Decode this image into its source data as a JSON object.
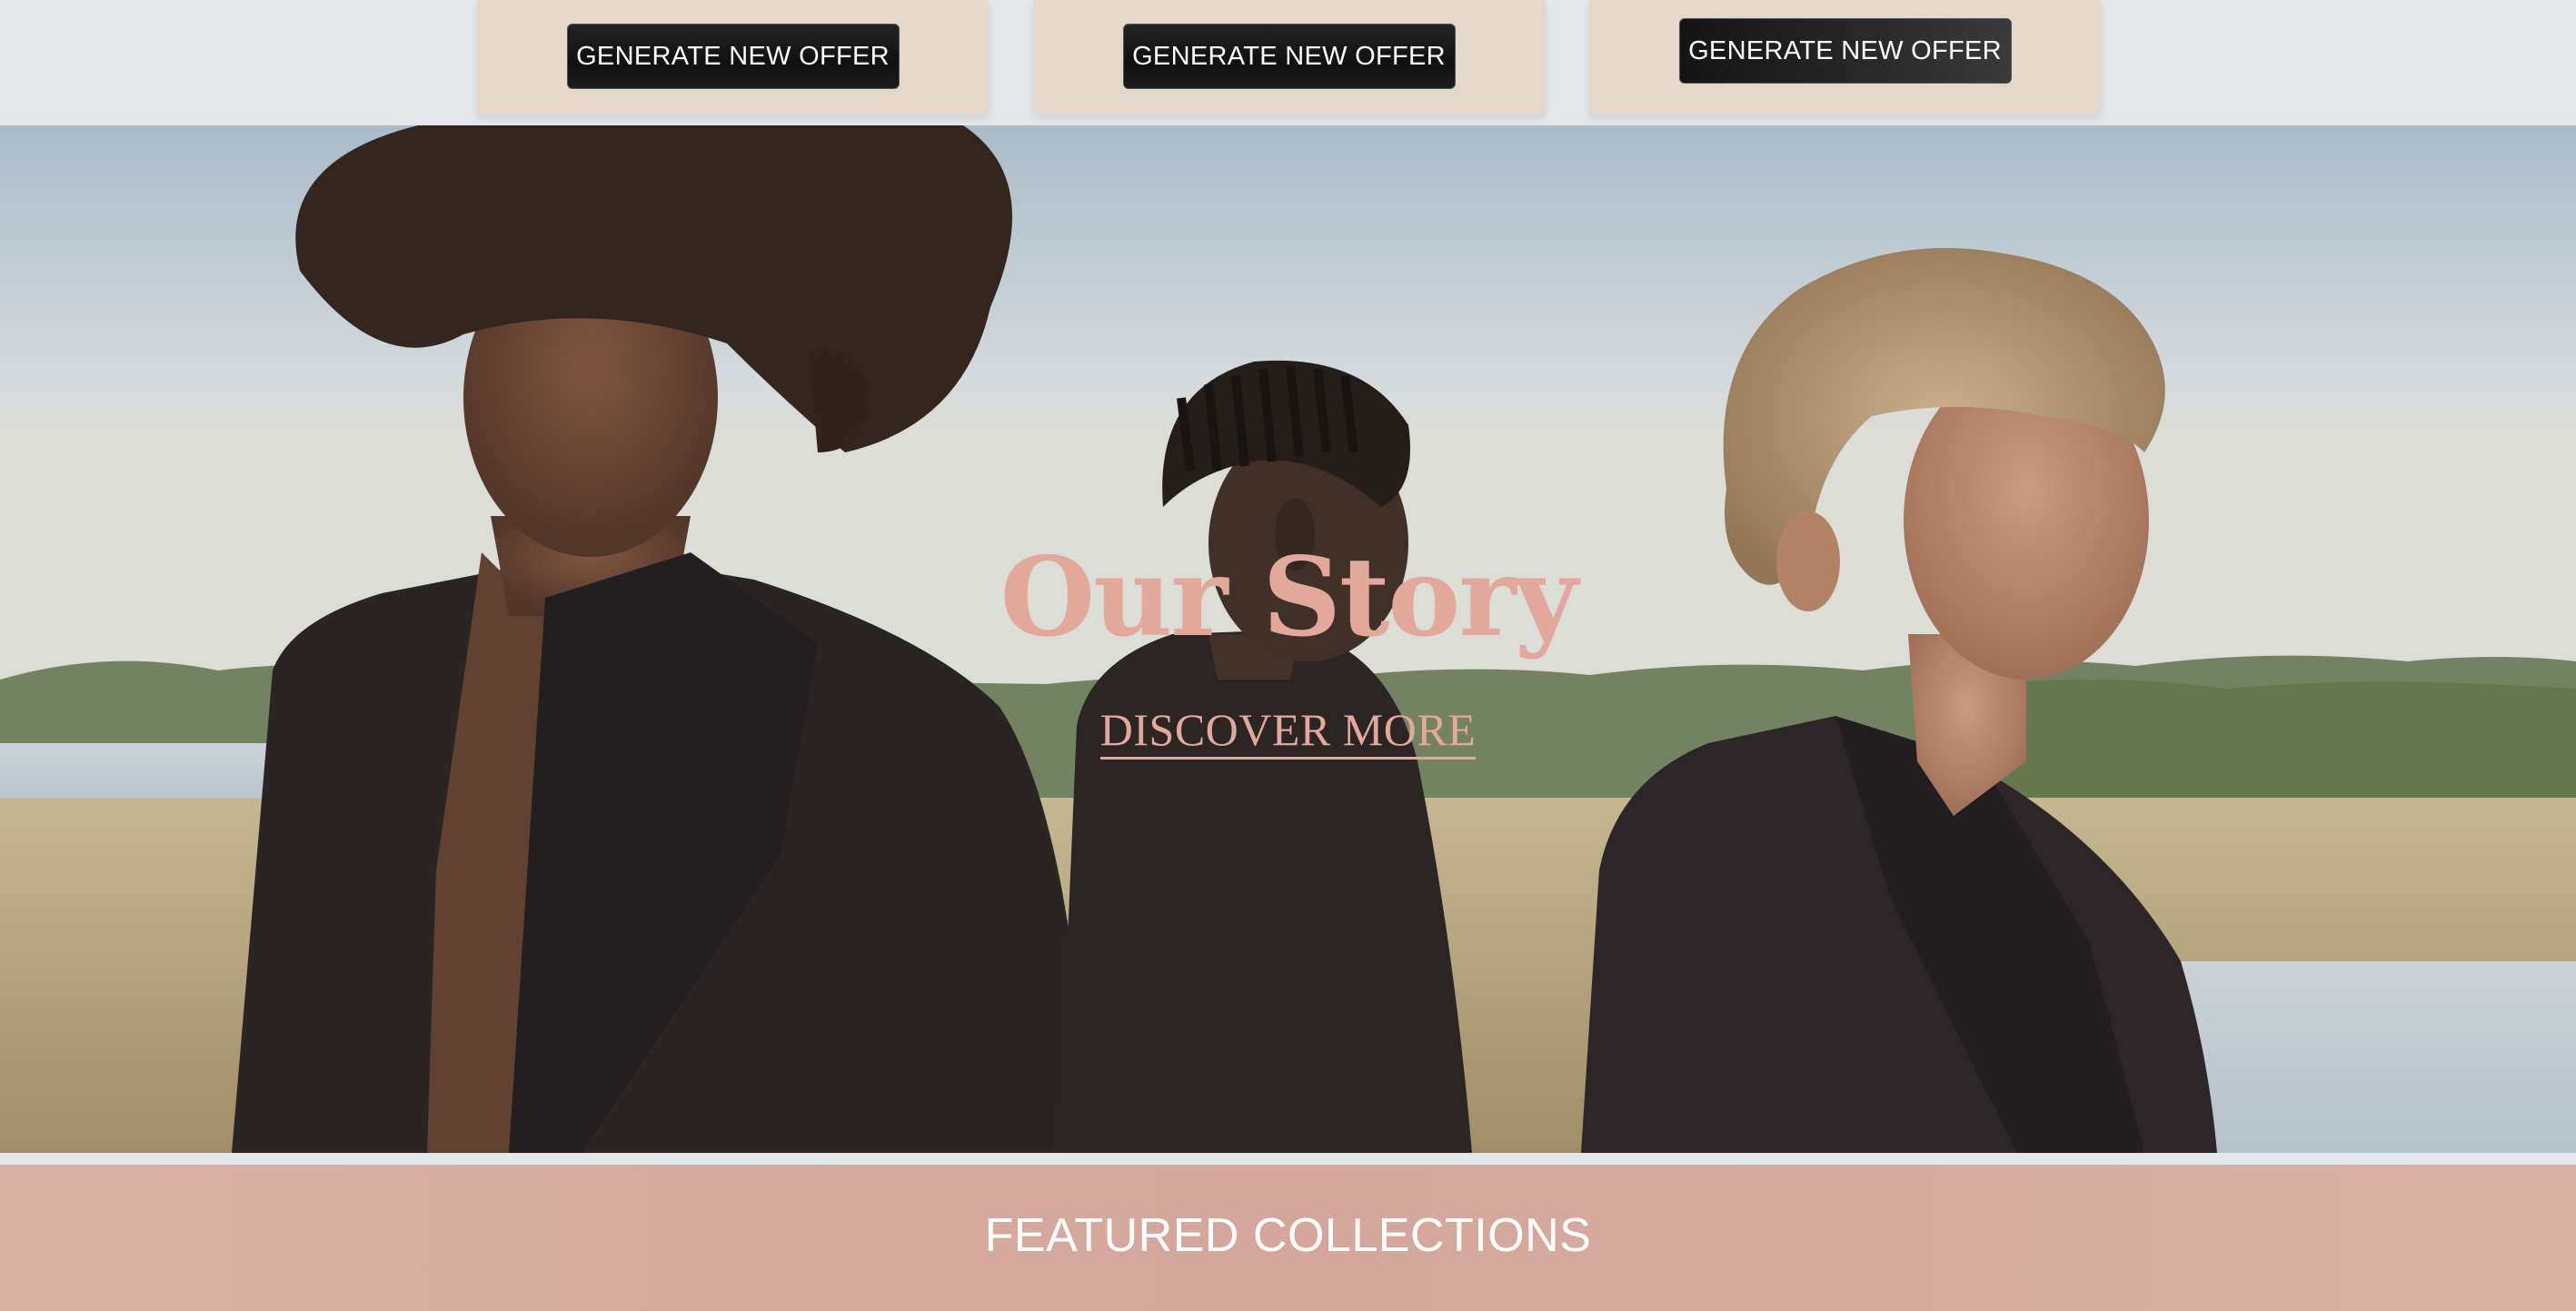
{
  "offers": {
    "cards": [
      {
        "button_label": "GENERATE NEW OFFER"
      },
      {
        "button_label": "GENERATE NEW OFFER"
      },
      {
        "button_label": "GENERATE NEW OFFER"
      }
    ]
  },
  "hero": {
    "title": "Our Story",
    "link_label": "DISCOVER MORE"
  },
  "featured": {
    "title": "FEATURED COLLECTIONS"
  },
  "colors": {
    "accent_pink": "#e2a89c",
    "card_beige": "#e5d7ca",
    "button_dark": "#111111",
    "band_pink": "#d4a69c"
  }
}
